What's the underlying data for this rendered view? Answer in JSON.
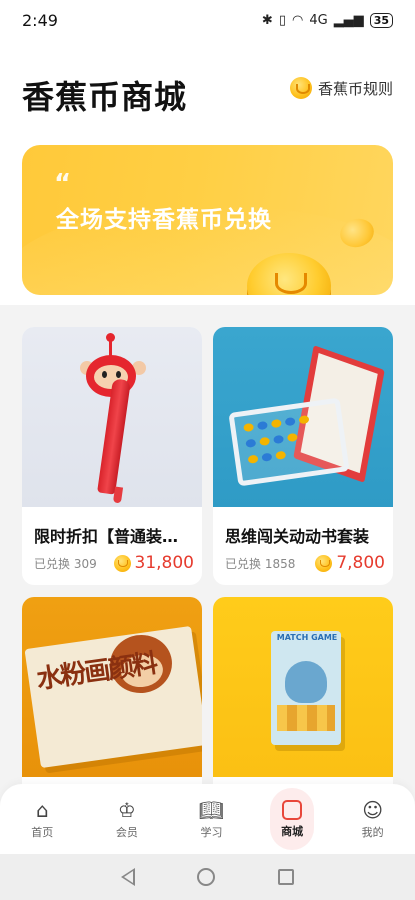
{
  "status_bar": {
    "time": "2:49",
    "icons": [
      "bluetooth-icon",
      "vibrate-icon",
      "wifi-icon",
      "signal-icon"
    ],
    "network_label": "4G",
    "battery": "35"
  },
  "header": {
    "title": "香蕉币商城",
    "rules_label": "香蕉币规则"
  },
  "banner": {
    "text": "全场支持香蕉币兑换",
    "accent": "#ffcb3d"
  },
  "products": [
    {
      "title": "限时折扣【普通装…",
      "exchanged": "已兑换 309",
      "price": "31,800"
    },
    {
      "title": "思维闯关动动书套装",
      "exchanged": "已兑换 1858",
      "price": "7,800"
    },
    {
      "title": "",
      "exchanged": "",
      "price": ""
    },
    {
      "title": "",
      "exchanged": "",
      "price": ""
    }
  ],
  "illustration_text": {
    "paint_title": "水粉画颜料",
    "match_title": "MATCH GAME"
  },
  "bottom_nav": [
    {
      "label": "首页",
      "icon": "home-icon",
      "active": false
    },
    {
      "label": "会员",
      "icon": "crown-icon",
      "active": false
    },
    {
      "label": "学习",
      "icon": "book-icon",
      "active": false
    },
    {
      "label": "商城",
      "icon": "shopping-bag-icon",
      "active": true
    },
    {
      "label": "我的",
      "icon": "profile-icon",
      "active": false
    }
  ],
  "colors": {
    "price": "#e63b2e",
    "active_nav": "#e8463a",
    "active_nav_bg": "#fdecec"
  }
}
